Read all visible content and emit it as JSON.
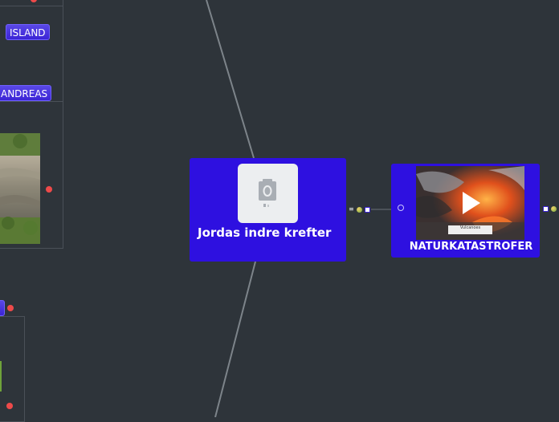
{
  "side_nodes": {
    "island_label": "ISLAND",
    "andreas_label": "ANDREAS"
  },
  "central_node": {
    "title": "Jordas indre krefter",
    "image_icon": "camera-placeholder-icon"
  },
  "right_node": {
    "title": "NATURKATASTROFER",
    "video_icon": "play-icon",
    "video_caption": "Vulcanoes"
  },
  "colors": {
    "background": "#2e343a",
    "node": "#2e10e0",
    "accent_red": "#ee4a4a",
    "connector": "#8a9096"
  }
}
